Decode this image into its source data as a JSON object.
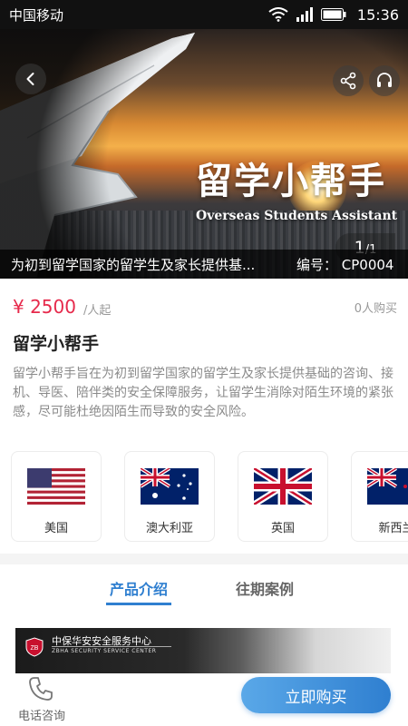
{
  "status_bar": {
    "carrier": "中国移动",
    "time": "15:36"
  },
  "hero": {
    "title": "留学小帮手",
    "subtitle": "Overseas Students Assistant",
    "page_current": "1",
    "page_total": "/1",
    "caption": "为初到留学国家的留学生及家长提供基...",
    "code": "编号： CP0004"
  },
  "product": {
    "price": "¥ 2500",
    "price_unit": "/人起",
    "buyers": "0人购买",
    "title": "留学小帮手",
    "description": "留学小帮手旨在为初到留学国家的留学生及家长提供基础的咨询、接机、导医、陪伴类的安全保障服务，让留学生消除对陌生环境的紧张感，尽可能杜绝因陌生而导致的安全风险。"
  },
  "countries": [
    {
      "name": "美国",
      "flag": "us-flag"
    },
    {
      "name": "澳大利亚",
      "flag": "au-flag"
    },
    {
      "name": "英国",
      "flag": "uk-flag"
    },
    {
      "name": "新西兰",
      "flag": "nz-flag"
    }
  ],
  "tabs": {
    "intro": "产品介绍",
    "cases": "往期案例"
  },
  "content_banner": {
    "company_cn": "中保华安安全服务中心",
    "company_en": "ZBHA SECURITY SERVICE CENTER"
  },
  "bottom_bar": {
    "phone_label": "电话咨询",
    "buy_label": "立即购买"
  },
  "colors": {
    "accent": "#2f7fd0",
    "price": "#e6294b"
  }
}
